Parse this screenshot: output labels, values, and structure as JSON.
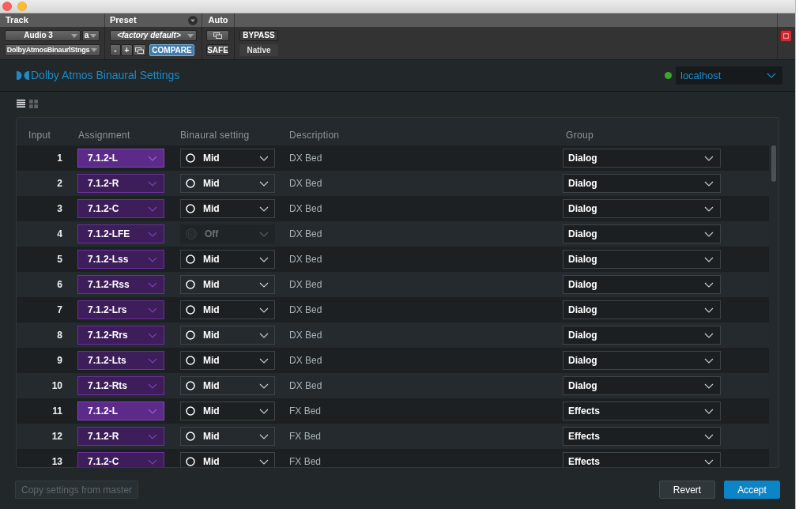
{
  "plugin_header": {
    "track": {
      "label": "Track",
      "name": "Audio 3",
      "channel": "a",
      "insert": "DolbyAtmosBinaurlStngs"
    },
    "preset": {
      "label": "Preset",
      "name": "<factory default>",
      "decrement": "-",
      "increment": "+",
      "compare": {
        "label": "COMPARE",
        "on": true
      }
    },
    "auto": {
      "label": "Auto",
      "safe": "SAFE"
    },
    "bypass": "BYPASS",
    "mode": "Native"
  },
  "app": {
    "title": "Dolby Atmos Binaural Settings",
    "connection": {
      "host": "localhost",
      "connected": true
    },
    "view_modes": [
      {
        "kind": "list",
        "selected": true
      },
      {
        "kind": "grid",
        "selected": false
      }
    ]
  },
  "table": {
    "columns": [
      "Input",
      "Assignment",
      "Binaural setting",
      "Description",
      "Group"
    ],
    "rows": [
      {
        "input": "1",
        "assignment": "7.1.2-L",
        "highlighted": true,
        "binaural": "Mid",
        "binaural_disabled": false,
        "description": "DX Bed",
        "group": "Dialog"
      },
      {
        "input": "2",
        "assignment": "7.1.2-R",
        "highlighted": false,
        "binaural": "Mid",
        "binaural_disabled": false,
        "description": "DX Bed",
        "group": "Dialog"
      },
      {
        "input": "3",
        "assignment": "7.1.2-C",
        "highlighted": false,
        "binaural": "Mid",
        "binaural_disabled": false,
        "description": "DX Bed",
        "group": "Dialog"
      },
      {
        "input": "4",
        "assignment": "7.1.2-LFE",
        "highlighted": false,
        "binaural": "Off",
        "binaural_disabled": true,
        "description": "DX Bed",
        "group": "Dialog"
      },
      {
        "input": "5",
        "assignment": "7.1.2-Lss",
        "highlighted": false,
        "binaural": "Mid",
        "binaural_disabled": false,
        "description": "DX Bed",
        "group": "Dialog"
      },
      {
        "input": "6",
        "assignment": "7.1.2-Rss",
        "highlighted": false,
        "binaural": "Mid",
        "binaural_disabled": false,
        "description": "DX Bed",
        "group": "Dialog"
      },
      {
        "input": "7",
        "assignment": "7.1.2-Lrs",
        "highlighted": false,
        "binaural": "Mid",
        "binaural_disabled": false,
        "description": "DX Bed",
        "group": "Dialog"
      },
      {
        "input": "8",
        "assignment": "7.1.2-Rrs",
        "highlighted": false,
        "binaural": "Mid",
        "binaural_disabled": false,
        "description": "DX Bed",
        "group": "Dialog"
      },
      {
        "input": "9",
        "assignment": "7.1.2-Lts",
        "highlighted": false,
        "binaural": "Mid",
        "binaural_disabled": false,
        "description": "DX Bed",
        "group": "Dialog"
      },
      {
        "input": "10",
        "assignment": "7.1.2-Rts",
        "highlighted": false,
        "binaural": "Mid",
        "binaural_disabled": false,
        "description": "DX Bed",
        "group": "Dialog"
      },
      {
        "input": "11",
        "assignment": "7.1.2-L",
        "highlighted": true,
        "binaural": "Mid",
        "binaural_disabled": false,
        "description": "FX Bed",
        "group": "Effects"
      },
      {
        "input": "12",
        "assignment": "7.1.2-R",
        "highlighted": false,
        "binaural": "Mid",
        "binaural_disabled": false,
        "description": "FX Bed",
        "group": "Effects"
      },
      {
        "input": "13",
        "assignment": "7.1.2-C",
        "highlighted": false,
        "binaural": "Mid",
        "binaural_disabled": false,
        "description": "FX Bed",
        "group": "Effects"
      }
    ]
  },
  "footer": {
    "copy_button": {
      "label": "Copy settings from master",
      "disabled": true
    },
    "buttons": [
      {
        "label": "Revert",
        "kind": "secondary"
      },
      {
        "label": "Accept",
        "kind": "primary"
      }
    ]
  }
}
